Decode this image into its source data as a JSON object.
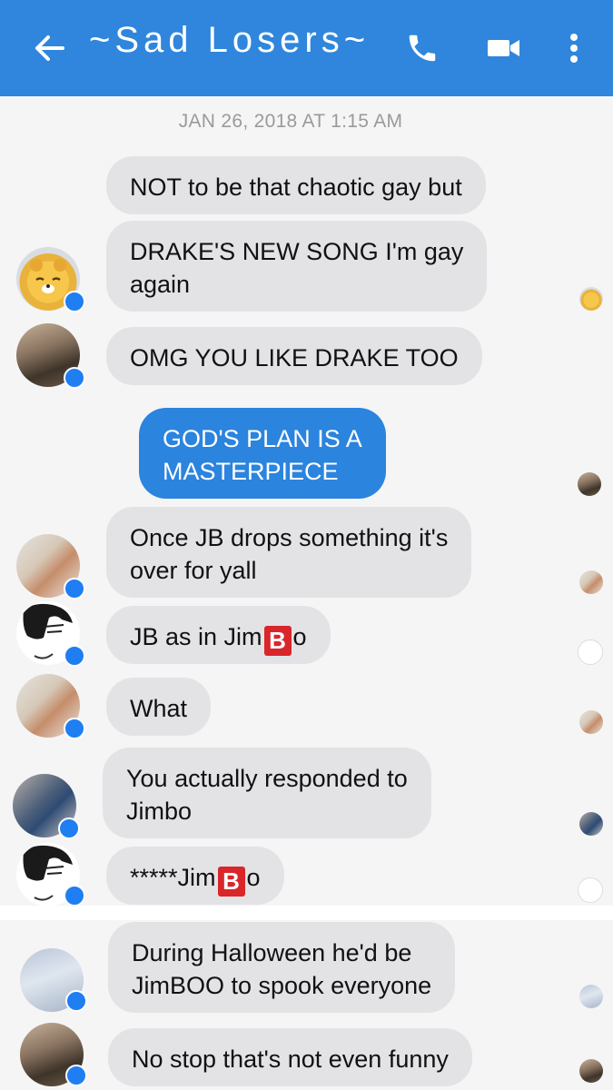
{
  "header": {
    "title": "~Sad Losers~",
    "icons": [
      "back-arrow-icon",
      "phone-icon",
      "video-camera-icon",
      "more-vertical-icon"
    ]
  },
  "date_separator": "JAN 26, 2018 AT 1:15 AM",
  "messages": [
    {
      "text": "NOT to be that chaotic gay but",
      "direction": "incoming"
    },
    {
      "text_line1": "DRAKE'S NEW SONG I'm gay",
      "text_line2": "again",
      "direction": "incoming"
    },
    {
      "text": "OMG YOU LIKE DRAKE TOO",
      "direction": "incoming"
    },
    {
      "text_line1": "GOD'S PLAN IS A",
      "text_line2": "MASTERPIECE",
      "direction": "outgoing"
    },
    {
      "text_line1": "Once JB drops something it's",
      "text_line2": "over for yall",
      "direction": "incoming"
    },
    {
      "text_before": "JB as in Jim",
      "glyph": "B",
      "text_after": "o",
      "direction": "incoming"
    },
    {
      "text": "What",
      "direction": "incoming"
    },
    {
      "text_line1": "You actually responded to",
      "text_line2": "Jimbo",
      "direction": "incoming"
    },
    {
      "text_before": "*****Jim",
      "glyph": "B",
      "text_after": "o",
      "direction": "incoming"
    },
    {
      "text_line1": "During Halloween he'd be",
      "text_line2": "JimBOO to spook everyone",
      "direction": "incoming"
    },
    {
      "text": "No stop that's not even funny",
      "direction": "incoming"
    }
  ],
  "colors": {
    "header": "#2f86dc",
    "outgoing_bubble": "#2b84de",
    "incoming_bubble": "#e3e3e6",
    "glyph_box": "#d9262b"
  }
}
